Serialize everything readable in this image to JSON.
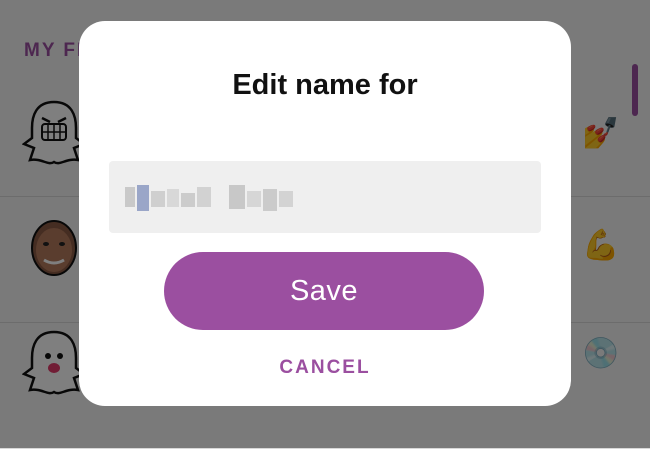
{
  "background": {
    "section_title": "MY FRIENDS",
    "friends": [
      {
        "avatar": "ghost-bitmoji-angry",
        "emoji": "💅"
      },
      {
        "avatar": "face-photo",
        "emoji": "💪"
      },
      {
        "avatar": "ghost-bitmoji-kiss",
        "emoji": "💿"
      }
    ],
    "bottom_text": ""
  },
  "dialog": {
    "title": "Edit name for",
    "subtitle": "",
    "name_input": {
      "value": "",
      "placeholder": ""
    },
    "save_label": "Save",
    "cancel_label": "CANCEL"
  },
  "colors": {
    "accent": "#9b4fa0",
    "overlay": "rgba(0,0,0,0.5)",
    "field_bg": "#efefef"
  }
}
